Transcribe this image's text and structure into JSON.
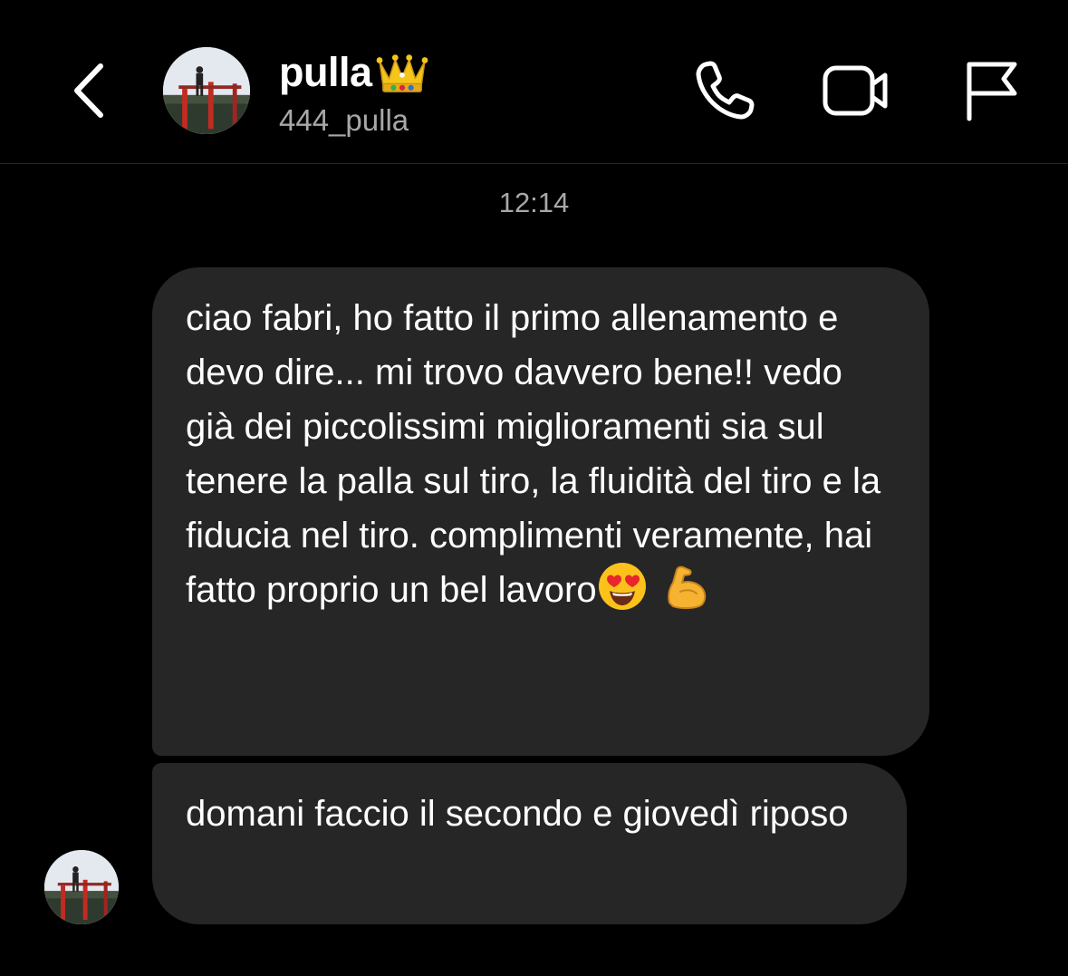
{
  "header": {
    "contact_name": "pulla",
    "contact_username": "444_pulla",
    "icons": {
      "back": "chevron-left-icon",
      "call": "phone-icon",
      "video": "video-camera-icon",
      "report": "flag-icon",
      "name_badge": "crown-emoji"
    }
  },
  "conversation": {
    "timestamp": "12:14",
    "messages": [
      {
        "text": "ciao fabri, ho fatto il primo allenamento e devo dire... mi trovo davvero bene!! vedo già dei piccolissimi miglioramenti sia sul tenere la palla sul tiro, la fluidità del tiro e la fiducia nel tiro. complimenti veramente, hai fatto proprio un bel lavoro",
        "emojis": [
          "heart-eyes-emoji",
          "flexed-biceps-emoji"
        ]
      },
      {
        "text": "domani faccio il secondo e giovedì riposo"
      }
    ]
  },
  "colors": {
    "background": "#000000",
    "bubble": "#262626",
    "text": "#ffffff",
    "secondary_text": "#a8a8a8"
  }
}
